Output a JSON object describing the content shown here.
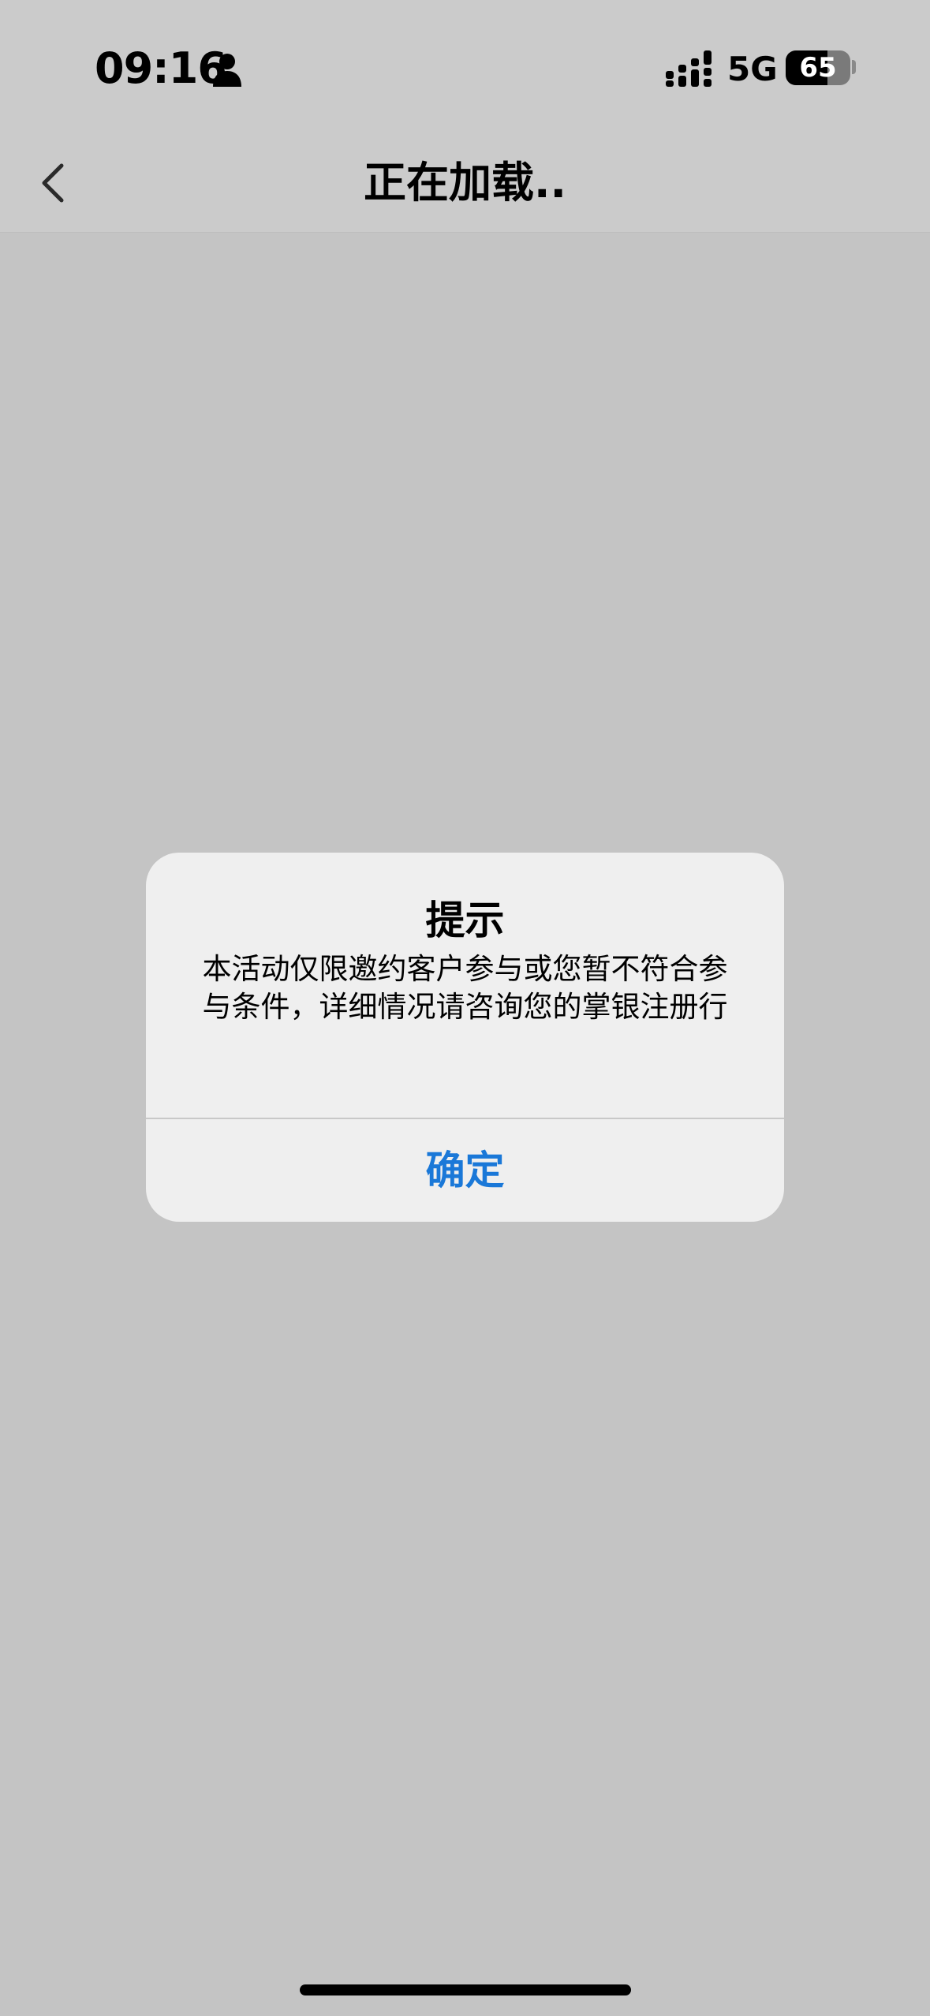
{
  "status_bar": {
    "time": "09:16",
    "network": "5G",
    "battery_level": "65",
    "battery_fraction": 0.65,
    "person_icon": "person-icon",
    "signal_icon": "signal-icon"
  },
  "nav": {
    "title": "正在加载..",
    "back_icon": "chevron-left-icon"
  },
  "alert": {
    "title": "提示",
    "message": "本活动仅限邀约客户参与或您暂不符合参与条件，详细情况请咨询您的掌银注册行",
    "confirm_label": "确定",
    "accent_color": "#1a78d8"
  }
}
